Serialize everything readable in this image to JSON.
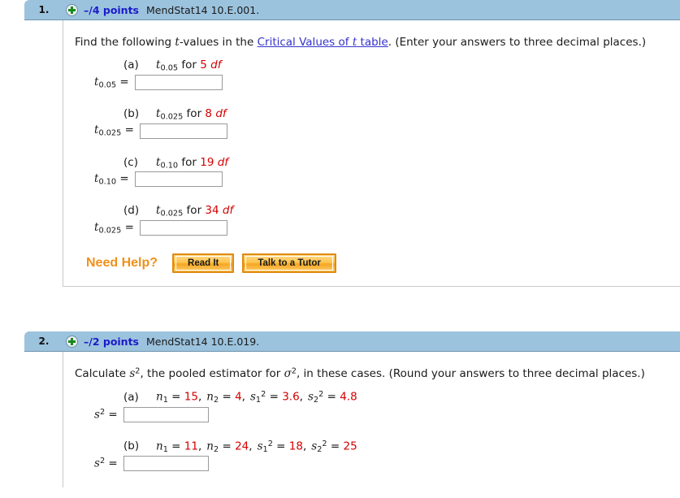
{
  "questions": [
    {
      "number": "1.",
      "plus_icon": "plus-circle-icon",
      "points": "–/4 points",
      "code": "MendStat14 10.E.001.",
      "prompt": {
        "before_link": "Find the following ",
        "italic_t": "t",
        "after_t": "-values in the ",
        "link_pre": "Critical Values of ",
        "link_italic": "t",
        "link_post": " table",
        "period": ".",
        "instruction": " (Enter your answers to three decimal places.)"
      },
      "parts": [
        {
          "label": "(a)",
          "stat_var": "t",
          "stat_sub": "0.05",
          "for_text": " for ",
          "df_value": "5",
          "df_unit": "df",
          "answer_var": "t",
          "answer_sub": "0.05",
          "equals": "=",
          "answer_value": "",
          "input_width": 108
        },
        {
          "label": "(b)",
          "stat_var": "t",
          "stat_sub": "0.025",
          "for_text": " for ",
          "df_value": "8",
          "df_unit": "df",
          "answer_var": "t",
          "answer_sub": "0.025",
          "equals": "=",
          "answer_value": "",
          "input_width": 108
        },
        {
          "label": "(c)",
          "stat_var": "t",
          "stat_sub": "0.10",
          "for_text": " for ",
          "df_value": "19",
          "df_unit": "df",
          "answer_var": "t",
          "answer_sub": "0.10",
          "equals": "=",
          "answer_value": "",
          "input_width": 108
        },
        {
          "label": "(d)",
          "stat_var": "t",
          "stat_sub": "0.025",
          "for_text": " for ",
          "df_value": "34",
          "df_unit": "df",
          "answer_var": "t",
          "answer_sub": "0.025",
          "equals": "=",
          "answer_value": "",
          "input_width": 108
        }
      ],
      "need_help": {
        "label": "Need Help?",
        "buttons": [
          {
            "label": "Read It"
          },
          {
            "label": "Talk to a Tutor"
          }
        ]
      }
    },
    {
      "number": "2.",
      "plus_icon": "plus-circle-icon",
      "points": "–/2 points",
      "code": "MendStat14 10.E.019.",
      "prompt": {
        "calc": "Calculate ",
        "s_var": "s",
        "s_exp": "2",
        "mid": ", the pooled estimator for ",
        "sigma_var": "σ",
        "sigma_exp": "2",
        "cases": ", in these cases.",
        "instruction": " (Round your answers to three decimal places.)"
      },
      "parts": [
        {
          "label": "(a)",
          "n1_var": "n",
          "n1_sub": "1",
          "n1_value": "15",
          "n2_var": "n",
          "n2_sub": "2",
          "n2_value": "4",
          "s1_var": "s",
          "s1_sub": "1",
          "s1_exp": "2",
          "s1_value": "3.6",
          "s2_var": "s",
          "s2_sub": "2",
          "s2_exp": "2",
          "s2_value": "4.8",
          "answer_var": "s",
          "answer_exp": "2",
          "equals": "=",
          "answer_value": "",
          "input_width": 105
        },
        {
          "label": "(b)",
          "n1_var": "n",
          "n1_sub": "1",
          "n1_value": "11",
          "n2_var": "n",
          "n2_sub": "2",
          "n2_value": "24",
          "s1_var": "s",
          "s1_sub": "1",
          "s1_exp": "2",
          "s1_value": "18",
          "s2_var": "s",
          "s2_sub": "2",
          "s2_exp": "2",
          "s2_value": "25",
          "answer_var": "s",
          "answer_exp": "2",
          "equals": "=",
          "answer_value": "",
          "input_width": 105
        }
      ]
    }
  ],
  "colors": {
    "header_bar": "#9cc3de",
    "points_text": "#1b1bc9",
    "link": "#3333cc",
    "value_red": "#d40000",
    "need_help_orange": "#f0901a"
  }
}
